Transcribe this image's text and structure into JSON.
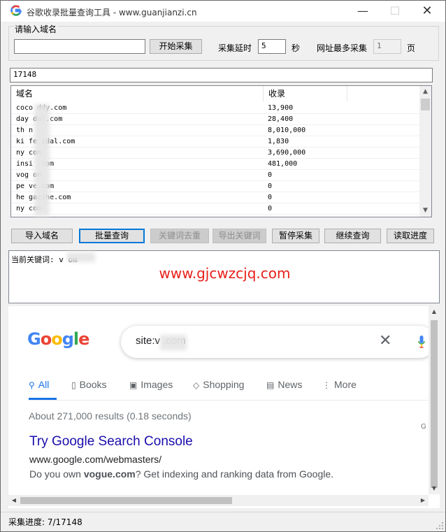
{
  "window": {
    "title": "谷歌收录批量查询工具 - www.guanjianzi.cn",
    "minimize_icon": "minimize-icon",
    "maximize_icon": "maximize-icon",
    "close_icon": "close-icon"
  },
  "domain_group": {
    "label": "请输入域名",
    "domain_value": "",
    "start_button": "开始采集",
    "delay_label": "采集延时",
    "delay_value": "5",
    "delay_unit": "秒",
    "max_pages_label": "网址最多采集",
    "max_pages_value": "1",
    "max_pages_unit": "页"
  },
  "count_field": "17148",
  "table": {
    "columns": [
      "域名",
      "收录"
    ],
    "rows": [
      {
        "domain": "coco  ddy.com",
        "count": "13,900"
      },
      {
        "domain": "day     dal.com",
        "count": "28,400"
      },
      {
        "domain": "th         n",
        "count": "8,010,000"
      },
      {
        "domain": "ki   fe   idal.com",
        "count": "1,830"
      },
      {
        "domain": "ny         com",
        "count": "3,690,000"
      },
      {
        "domain": "insi    .com",
        "count": "481,000"
      },
      {
        "domain": "vog    om",
        "count": "0"
      },
      {
        "domain": "pe     ve.com",
        "count": "0"
      },
      {
        "domain": "he   gazine.com",
        "count": "0"
      },
      {
        "domain": "ny       com",
        "count": "0"
      }
    ]
  },
  "buttons": {
    "import_domains": "导入域名",
    "batch_query": "批量查询",
    "dedupe_keywords": "关键词去重",
    "export_keywords": "导出关键词",
    "pause": "暂停采集",
    "continue": "继续查询",
    "read_progress": "读取进度"
  },
  "log": {
    "current_keyword": "当前关键词: v      om",
    "watermark": "www.gjcwzcjq.com"
  },
  "browser": {
    "search_query": "site:v      .com",
    "tabs": [
      {
        "label": "All",
        "icon": "search-icon"
      },
      {
        "label": "Books",
        "icon": "book-icon"
      },
      {
        "label": "Images",
        "icon": "image-icon"
      },
      {
        "label": "Shopping",
        "icon": "tag-icon"
      },
      {
        "label": "News",
        "icon": "news-icon"
      },
      {
        "label": "More",
        "icon": "more-dots-icon"
      }
    ],
    "result_stats": "About 271,000 results (0.18 seconds)",
    "result_title": "Try Google Search Console",
    "result_url": "www.google.com/webmasters/",
    "result_desc_prefix": "Do you own ",
    "result_desc_bold": "vogue.com",
    "result_desc_suffix": "? Get indexing and ranking data from Google.",
    "side_letter": "G"
  },
  "status": {
    "progress_label": "采集进度: 7/17148"
  },
  "colors": {
    "accent_blue": "#1a73e8",
    "link_blue": "#1a0dab",
    "watermark_red": "#e8201a",
    "button_focus": "#0078d7"
  }
}
